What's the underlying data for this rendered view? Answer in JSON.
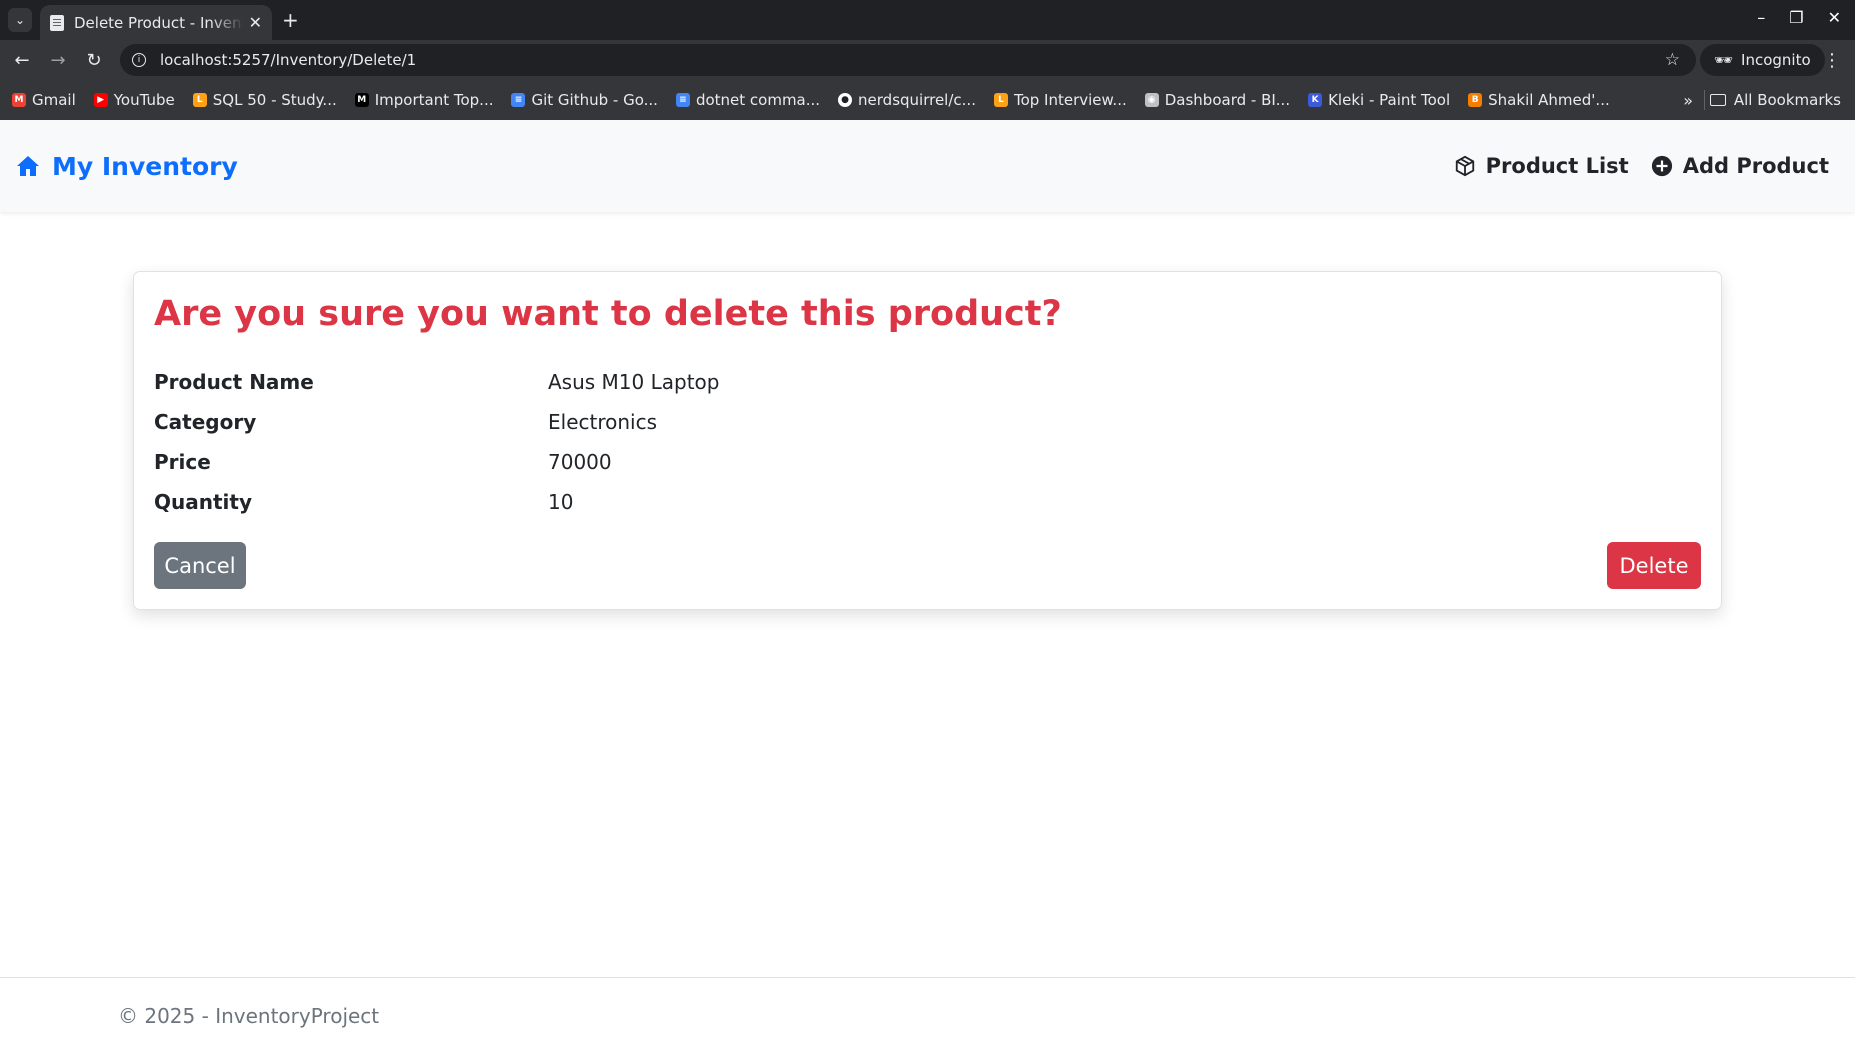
{
  "browser": {
    "tab_title": "Delete Product - InventoryProject",
    "url": "localhost:5257/Inventory/Delete/1",
    "incognito_label": "Incognito",
    "bookmarks": [
      {
        "label": "Gmail",
        "icon": "gmail-icon",
        "color": "#ea4335"
      },
      {
        "label": "YouTube",
        "icon": "youtube-icon",
        "color": "#ff0000"
      },
      {
        "label": "SQL 50 - Study...",
        "icon": "leetcode-icon",
        "color": "#ffa116"
      },
      {
        "label": "Important Top...",
        "icon": "medium-icon",
        "color": "#000000"
      },
      {
        "label": "Git Github - Go...",
        "icon": "docs-icon",
        "color": "#4285f4"
      },
      {
        "label": "dotnet comma...",
        "icon": "docs-icon",
        "color": "#4285f4"
      },
      {
        "label": "nerdsquirrel/c...",
        "icon": "github-icon",
        "color": "#ffffff"
      },
      {
        "label": "Top Interview...",
        "icon": "leetcode-icon",
        "color": "#ffa116"
      },
      {
        "label": "Dashboard - BI...",
        "icon": "globe-icon",
        "color": "#bdc1c6"
      },
      {
        "label": "Kleki - Paint Tool",
        "icon": "kleki-icon",
        "color": "#3b5bdb"
      },
      {
        "label": "Shakil Ahmed'...",
        "icon": "blogger-icon",
        "color": "#f57d00"
      }
    ],
    "all_bookmarks_label": "All Bookmarks"
  },
  "navbar": {
    "brand": "My Inventory",
    "links": [
      {
        "label": "Product List",
        "icon": "box-icon"
      },
      {
        "label": "Add Product",
        "icon": "plus-circle-icon"
      }
    ]
  },
  "card": {
    "title": "Are you sure you want to delete this product?",
    "details": [
      {
        "label": "Product Name",
        "value": "Asus M10 Laptop"
      },
      {
        "label": "Category",
        "value": "Electronics"
      },
      {
        "label": "Price",
        "value": "70000"
      },
      {
        "label": "Quantity",
        "value": "10"
      }
    ],
    "cancel_label": "Cancel",
    "delete_label": "Delete"
  },
  "footer": {
    "text": "© 2025 - InventoryProject"
  },
  "colors": {
    "brand": "#0d6efd",
    "danger": "#dc3545",
    "secondary": "#6c757d"
  }
}
